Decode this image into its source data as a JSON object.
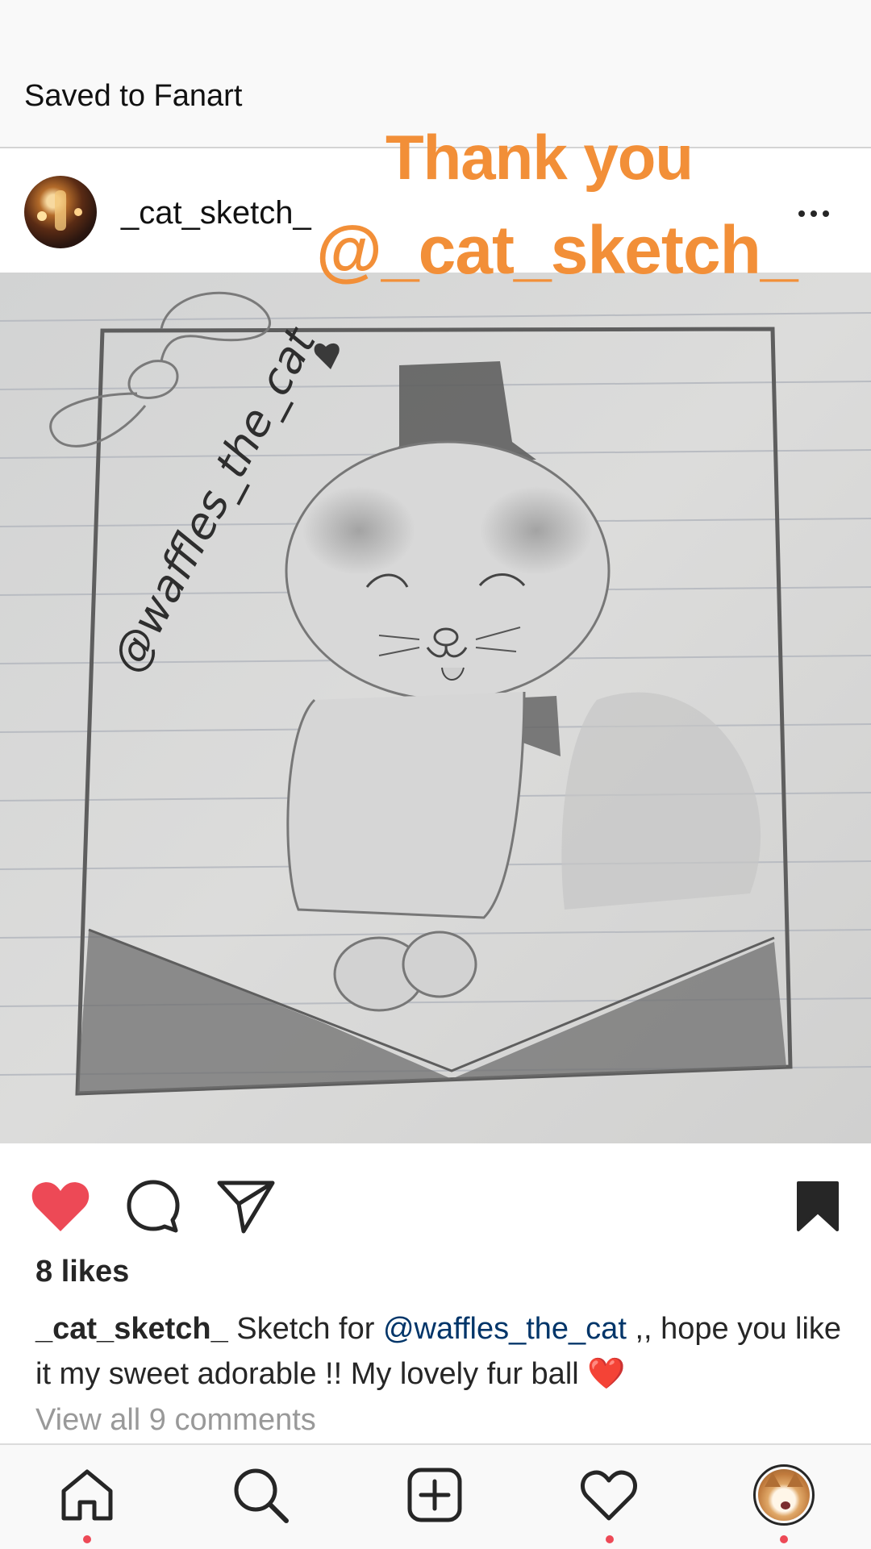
{
  "header": {
    "saved_label": "Saved to Fanart"
  },
  "post": {
    "username": "_cat_sketch_",
    "overlay_line1": "Thank you",
    "overlay_line2": "@_cat_sketch_",
    "drawing_signature": "@waffles_the_cat",
    "likes": "8 likes",
    "caption": {
      "user": "_cat_sketch_",
      "text_before": " Sketch for ",
      "mention": "@waffles_the_cat",
      "text_after": " ,, hope you like it my sweet adorable !! My lovely fur ball ",
      "emoji": "❤️"
    },
    "view_comments": "View all 9 comments"
  },
  "icons": {
    "like": "heart-filled-icon",
    "comment": "comment-bubble-icon",
    "share": "paper-plane-icon",
    "save": "bookmark-filled-icon",
    "more": "more-dots-icon"
  },
  "nav": {
    "items": [
      "home-icon",
      "search-icon",
      "add-post-icon",
      "activity-heart-icon",
      "profile-avatar"
    ]
  },
  "colors": {
    "accent_orange": "#f28f38",
    "like_red": "#ed4956",
    "mention_blue": "#003569",
    "notification_dot": "#ed4956"
  }
}
